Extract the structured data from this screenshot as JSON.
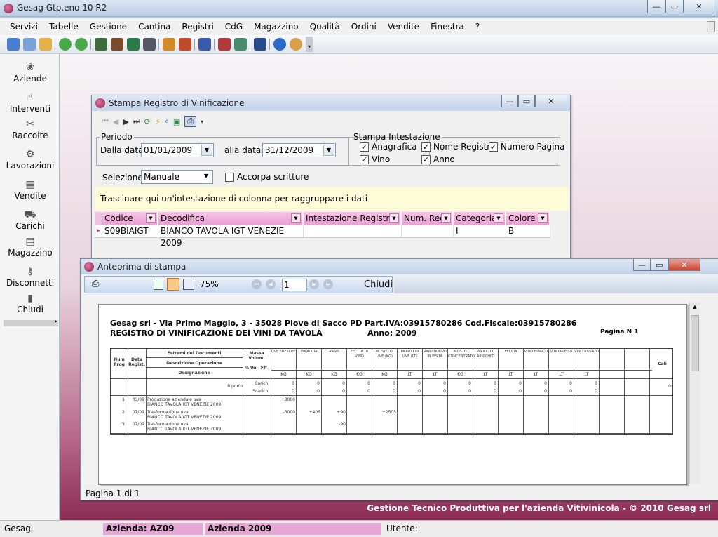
{
  "app": {
    "title": "Gesag Gtp.eno 10 R2"
  },
  "menu": [
    "Servizi",
    "Tabelle",
    "Gestione",
    "Cantina",
    "Registri",
    "CdG",
    "Magazzino",
    "Qualità",
    "Ordini",
    "Vendite",
    "Finestra",
    "?"
  ],
  "sidebar": [
    {
      "label": "Aziende",
      "icon": "company-icon"
    },
    {
      "label": "Interventi",
      "icon": "hand-icon"
    },
    {
      "label": "Raccolte",
      "icon": "harvest-icon"
    },
    {
      "label": "Lavorazioni",
      "icon": "press-icon"
    },
    {
      "label": "Vendite",
      "icon": "register-icon"
    },
    {
      "label": "Carichi",
      "icon": "truck-icon"
    },
    {
      "label": "Magazzino",
      "icon": "warehouse-icon"
    },
    {
      "label": "Disconnetti",
      "icon": "keys-icon"
    },
    {
      "label": "Chiudi",
      "icon": "door-icon"
    }
  ],
  "stampa": {
    "title": "Stampa Registro di Vinificazione",
    "periodo_legend": "Periodo",
    "dalla_label": "Dalla data:",
    "dalla_value": "01/01/2009",
    "alla_label": "alla data:",
    "alla_value": "31/12/2009",
    "intest_legend": "Stampa Intestazione",
    "checks": {
      "anagrafica": "Anagrafica",
      "nome_registro": "Nome Registro",
      "numero_pagina": "Numero Pagina",
      "vino": "Vino",
      "anno": "Anno"
    },
    "selezione_label": "Selezione:",
    "selezione_value": "Manuale",
    "accorpa_label": "Accorpa scritture",
    "group_hint": "Trascinare qui un'intestazione di colonna per raggruppare i dati",
    "columns": [
      "Codice",
      "Decodifica",
      "Intestazione Registro",
      "Num. Reg.",
      "Categoria",
      "Colore"
    ],
    "row": {
      "codice": "S09BIAIGT",
      "decodifica": "BIANCO TAVOLA IGT VENEZIE 2009",
      "intestazione": "",
      "num_reg": "",
      "categoria": "I",
      "colore": "B"
    }
  },
  "preview": {
    "title": "Anteprima di stampa",
    "zoom": "75%",
    "page_input": "1",
    "chiudi": "Chiudi",
    "status": "Pagina 1 di 1",
    "report": {
      "company": "Gesag srl - Via Primo Maggio, 3 - 35028 Piove di Sacco PD  Part.IVA:03915780286  Cod.Fiscale:03915780286",
      "title": "REGISTRO DI VINIFICAZIONE DEI VINI DA TAVOLA",
      "anno": "Anno: 2009",
      "pagina": "Pagina N 1",
      "h_numprog": "Num Prog",
      "h_data": "Data Regist.",
      "h_estremi": "Estremi del Documenti",
      "h_descr": "Descrizione Operazione",
      "h_desig": "Designazione",
      "h_massa": "Massa Volum.",
      "h_vol": "% Vol. Eff.",
      "cols": [
        "UVE FRESCHE",
        "VINACCIA",
        "RASPI",
        "FECCIA DI VINO",
        "MOSTO DI UVE (KG)",
        "MOSTO DI UVE (LT)",
        "VINO NUOVO IN FERM.",
        "MOSTO CONCENTRATO",
        "PRODOTTI ARRICHITI",
        "FECCIA",
        "VINO BIANCO",
        "VINO ROSSO",
        "VINO ROSATO",
        "",
        ""
      ],
      "units": [
        "KG",
        "KG",
        "KG",
        "KG",
        "KG",
        "LT",
        "LT",
        "KG",
        "LT",
        "LT",
        "LT",
        "LT",
        "LT",
        "",
        ""
      ],
      "cali": "Cali",
      "riporto": "Riporto",
      "carichi": "Carichi",
      "scarichi": "Scarichi",
      "zero": "0",
      "entries": [
        {
          "num": "1",
          "date": "03/09",
          "l1": "Produzione aziendale uva",
          "l2": "BIANCO TAVOLA IGT VENEZIE 2009"
        },
        {
          "num": "2",
          "date": "07/09",
          "l1": "Trasformazione uva",
          "l2": "BIANCO TAVOLA IGT VENEZIE 2009"
        },
        {
          "num": "3",
          "date": "07/09",
          "l1": "Trasformazione uva",
          "l2": "BIANCO TAVOLA IGT VENEZIE 2009"
        }
      ],
      "vals": {
        "uve_plus": "+3000",
        "uve_minus": "-3000",
        "vinaccia": "+405",
        "raspi1": "+90",
        "raspi2": "-90",
        "mosto": "+2505"
      }
    }
  },
  "footer": "Gestione Tecnico Produttiva per l'azienda Vitivinicola - © 2010 Gesag srl",
  "status": {
    "app": "Gesag",
    "azienda_code": "Azienda: AZ09",
    "azienda_year": "Azienda 2009",
    "utente": "Utente:"
  }
}
